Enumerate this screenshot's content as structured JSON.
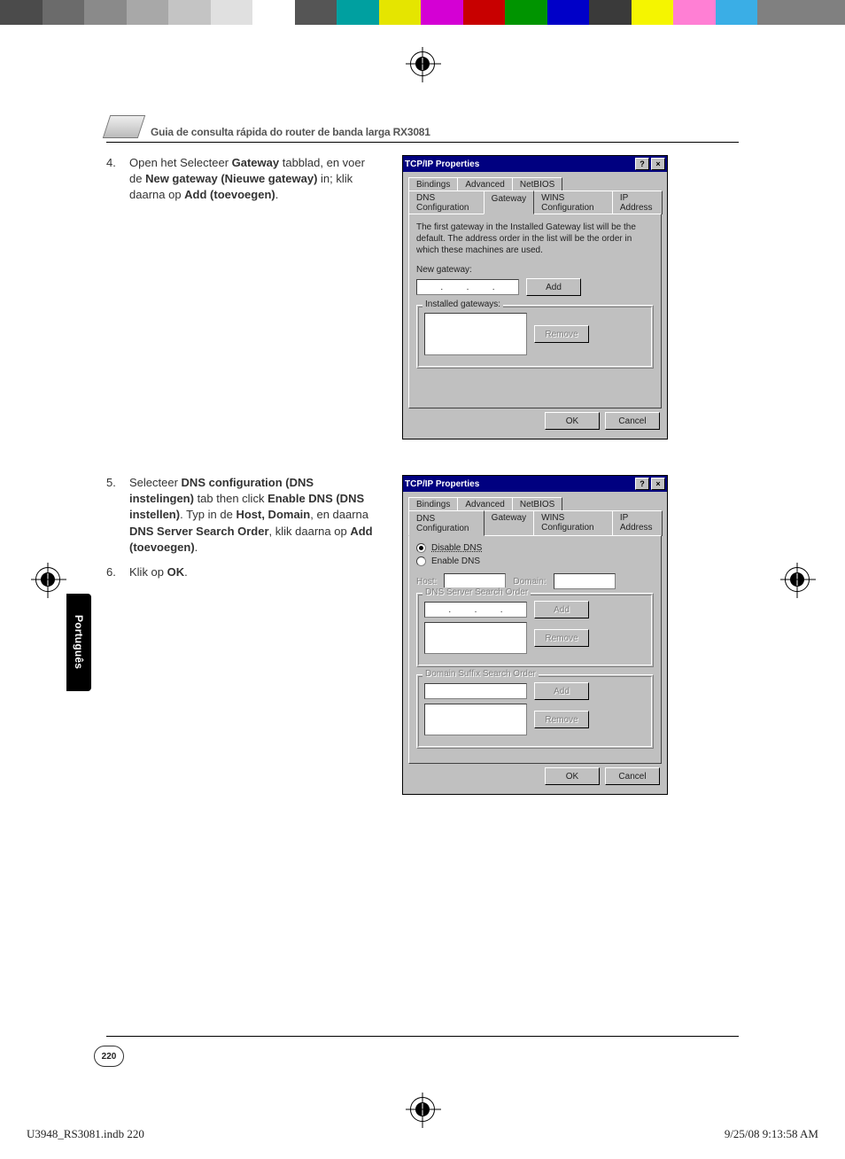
{
  "colorbar": [
    "#4b4b4b",
    "#6b6b6b",
    "#8a8a8a",
    "#a8a8a8",
    "#c4c4c4",
    "#e0e0e0",
    "#ffffff",
    "#555555",
    "#00a0a0",
    "#e5e500",
    "#d400d4",
    "#c80000",
    "#009400",
    "#0000c8",
    "#3a3a3a",
    "#f5f500",
    "#ff7fd4",
    "#3aaee6",
    "#808080"
  ],
  "header_title": "Guia de consulta rápida do router de banda larga RX3081",
  "lang_tab": "Português",
  "page_number": "220",
  "print_footer": {
    "file": "U3948_RS3081.indb   220",
    "datetime": "9/25/08   9:13:58 AM"
  },
  "steps": {
    "s4": {
      "num": "4.",
      "t1": "Open het Selecteer ",
      "b1": "Gateway",
      "t2": " tabblad, en voer de  ",
      "b2": "New gateway (Nieuwe gateway)",
      "t3": " in; klik daarna op ",
      "b3": "Add (toevoegen)",
      "t4": "."
    },
    "s5": {
      "num": "5.",
      "t1": "Selecteer ",
      "b1": "DNS configuration (DNS instelingen)",
      "t2": " tab then click ",
      "b2": "Enable DNS (DNS instellen)",
      "t3": ". Typ in de ",
      "b3": "Host, Domain",
      "t4": ", en daarna ",
      "b4": "DNS Server Search Order",
      "t5": ", klik daarna op ",
      "b5": "Add (toevoegen)",
      "t6": "."
    },
    "s6": {
      "num": "6.",
      "t1": "Klik op ",
      "b1": "OK",
      "t2": "."
    }
  },
  "dlg": {
    "title": "TCP/IP Properties",
    "help": "?",
    "close": "×",
    "tabs_back": [
      "Bindings",
      "Advanced",
      "NetBIOS"
    ],
    "tabs_front": [
      "DNS Configuration",
      "Gateway",
      "WINS Configuration",
      "IP Address"
    ],
    "ok": "OK",
    "cancel": "Cancel",
    "gateway": {
      "note": "The first gateway in the Installed Gateway list will be the default. The address order in the list will be the order in which these machines are used.",
      "new_label": "New gateway:",
      "add": "Add",
      "installed_label": "Installed gateways:",
      "remove": "Remove",
      "ip_dots": ". . ."
    },
    "dns": {
      "disable": "Disable DNS",
      "enable": "Enable DNS",
      "host": "Host:",
      "domain": "Domain:",
      "search": "DNS Server Search Order",
      "suffix": "Domain Suffix Search Order",
      "add": "Add",
      "remove": "Remove"
    }
  }
}
